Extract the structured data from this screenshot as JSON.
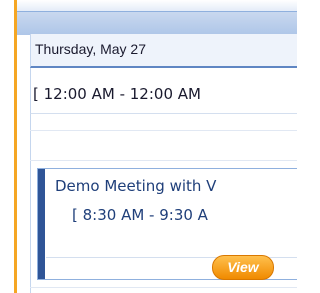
{
  "day_header": {
    "date": "Thursday, May 27"
  },
  "all_day": {
    "time_range": "[ 12:00 AM - 12:00 AM"
  },
  "event": {
    "title": "Demo Meeting with V",
    "time_range": "[ 8:30 AM - 9:30 A"
  },
  "actions": {
    "view_label": "View"
  },
  "colors": {
    "accent_orange": "#f5a623",
    "header_blue": "#aec6e8",
    "event_stripe": "#2f5597",
    "text_blue": "#1f3f7a"
  }
}
